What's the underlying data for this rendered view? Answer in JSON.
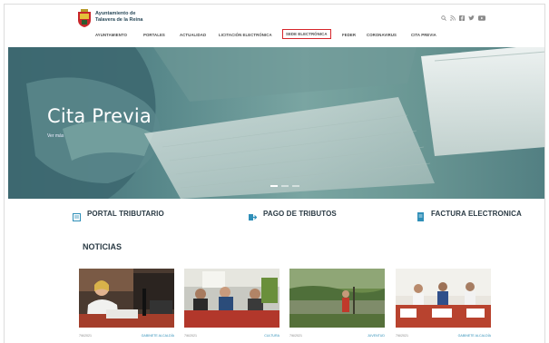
{
  "header": {
    "brand_line1": "Ayuntamiento de",
    "brand_line2": "Talavera de la Reina",
    "icons": [
      "search-icon",
      "rss-icon",
      "facebook-icon",
      "twitter-icon",
      "youtube-icon"
    ]
  },
  "nav": [
    {
      "label": "AYUNTAMIENTO"
    },
    {
      "label": "PORTALES"
    },
    {
      "label": "ACTUALIDAD"
    },
    {
      "label": "LICITACIÓN ELECTRÓNICA"
    },
    {
      "label": "SEDE ELECTRÓNICA",
      "highlighted": true
    },
    {
      "label": "FEDER"
    },
    {
      "label": "CORONAVIRUS"
    },
    {
      "label": "CITA PREVIA"
    }
  ],
  "hero": {
    "title": "Cita Previa",
    "more": "Ver más",
    "slide_count": 3,
    "active_slide": 1
  },
  "quick_links": [
    {
      "label": "PORTAL TRIBUTARIO",
      "icon": "document-icon"
    },
    {
      "label": "PAGO DE TRIBUTOS",
      "icon": "payment-arrow-icon"
    },
    {
      "label": "FACTURA ELECTRONICA",
      "icon": "invoice-icon"
    }
  ],
  "news": {
    "title": "NOTICIAS",
    "items": [
      {
        "date": "7/6/2021",
        "category": "GABINETE ALCALDÍA"
      },
      {
        "date": "7/6/2021",
        "category": "CULTURA"
      },
      {
        "date": "7/6/2021",
        "category": "JUVENTUD"
      },
      {
        "date": "7/6/2021",
        "category": "GABINETE ALCALDÍA"
      }
    ]
  },
  "colors": {
    "accent": "#d6262b",
    "link": "#2f8fb8",
    "quick_icon": "#2f8fb8"
  }
}
